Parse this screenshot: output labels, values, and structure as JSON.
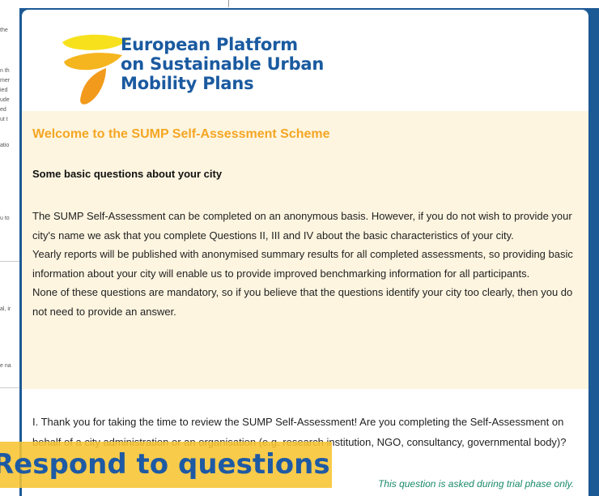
{
  "background": {
    "fragments": [
      "the",
      "n th",
      "mer",
      "ied",
      "ude",
      "ed",
      "ut t",
      "atio",
      "u to",
      "al, ir",
      "e na"
    ]
  },
  "modal": {
    "brand": {
      "line1": "European Platform",
      "line2": "on Sustainable Urban",
      "line3": "Mobility Plans"
    },
    "welcome_title": "Welcome to the SUMP Self-Assessment Scheme",
    "sub_heading": "Some basic questions about your city",
    "intro_paragraphs": [
      "The SUMP Self-Assessment can be completed on an anonymous basis. However, if you do not wish to provide your city's name we ask that you complete Questions II, III and IV about the basic characteristics of your city.",
      "Yearly reports will be published with anonymised summary results for all completed assessments, so providing basic information about your city will enable us to provide improved benchmarking information for all participants.",
      "None of these questions are mandatory, so if you believe that the questions identify your city too clearly, then you do not need to provide an answer."
    ],
    "question_text": "I. Thank you for taking the time to review the SUMP Self-Assessment! Are you completing the Self-Assessment on behalf of a city administration or an organisation (e.g. research institution, NGO, consultancy, governmental body)?",
    "question_note": "This question is asked during trial phase only."
  },
  "caption": "Respond to questions",
  "colors": {
    "backdrop": "#1c5a96",
    "brand_blue": "#1a5aa0",
    "accent_orange": "#f5a623",
    "panel_cream": "#fdf5e0",
    "note_green": "#1a8a6a",
    "caption_yellow": "#f8c432"
  }
}
